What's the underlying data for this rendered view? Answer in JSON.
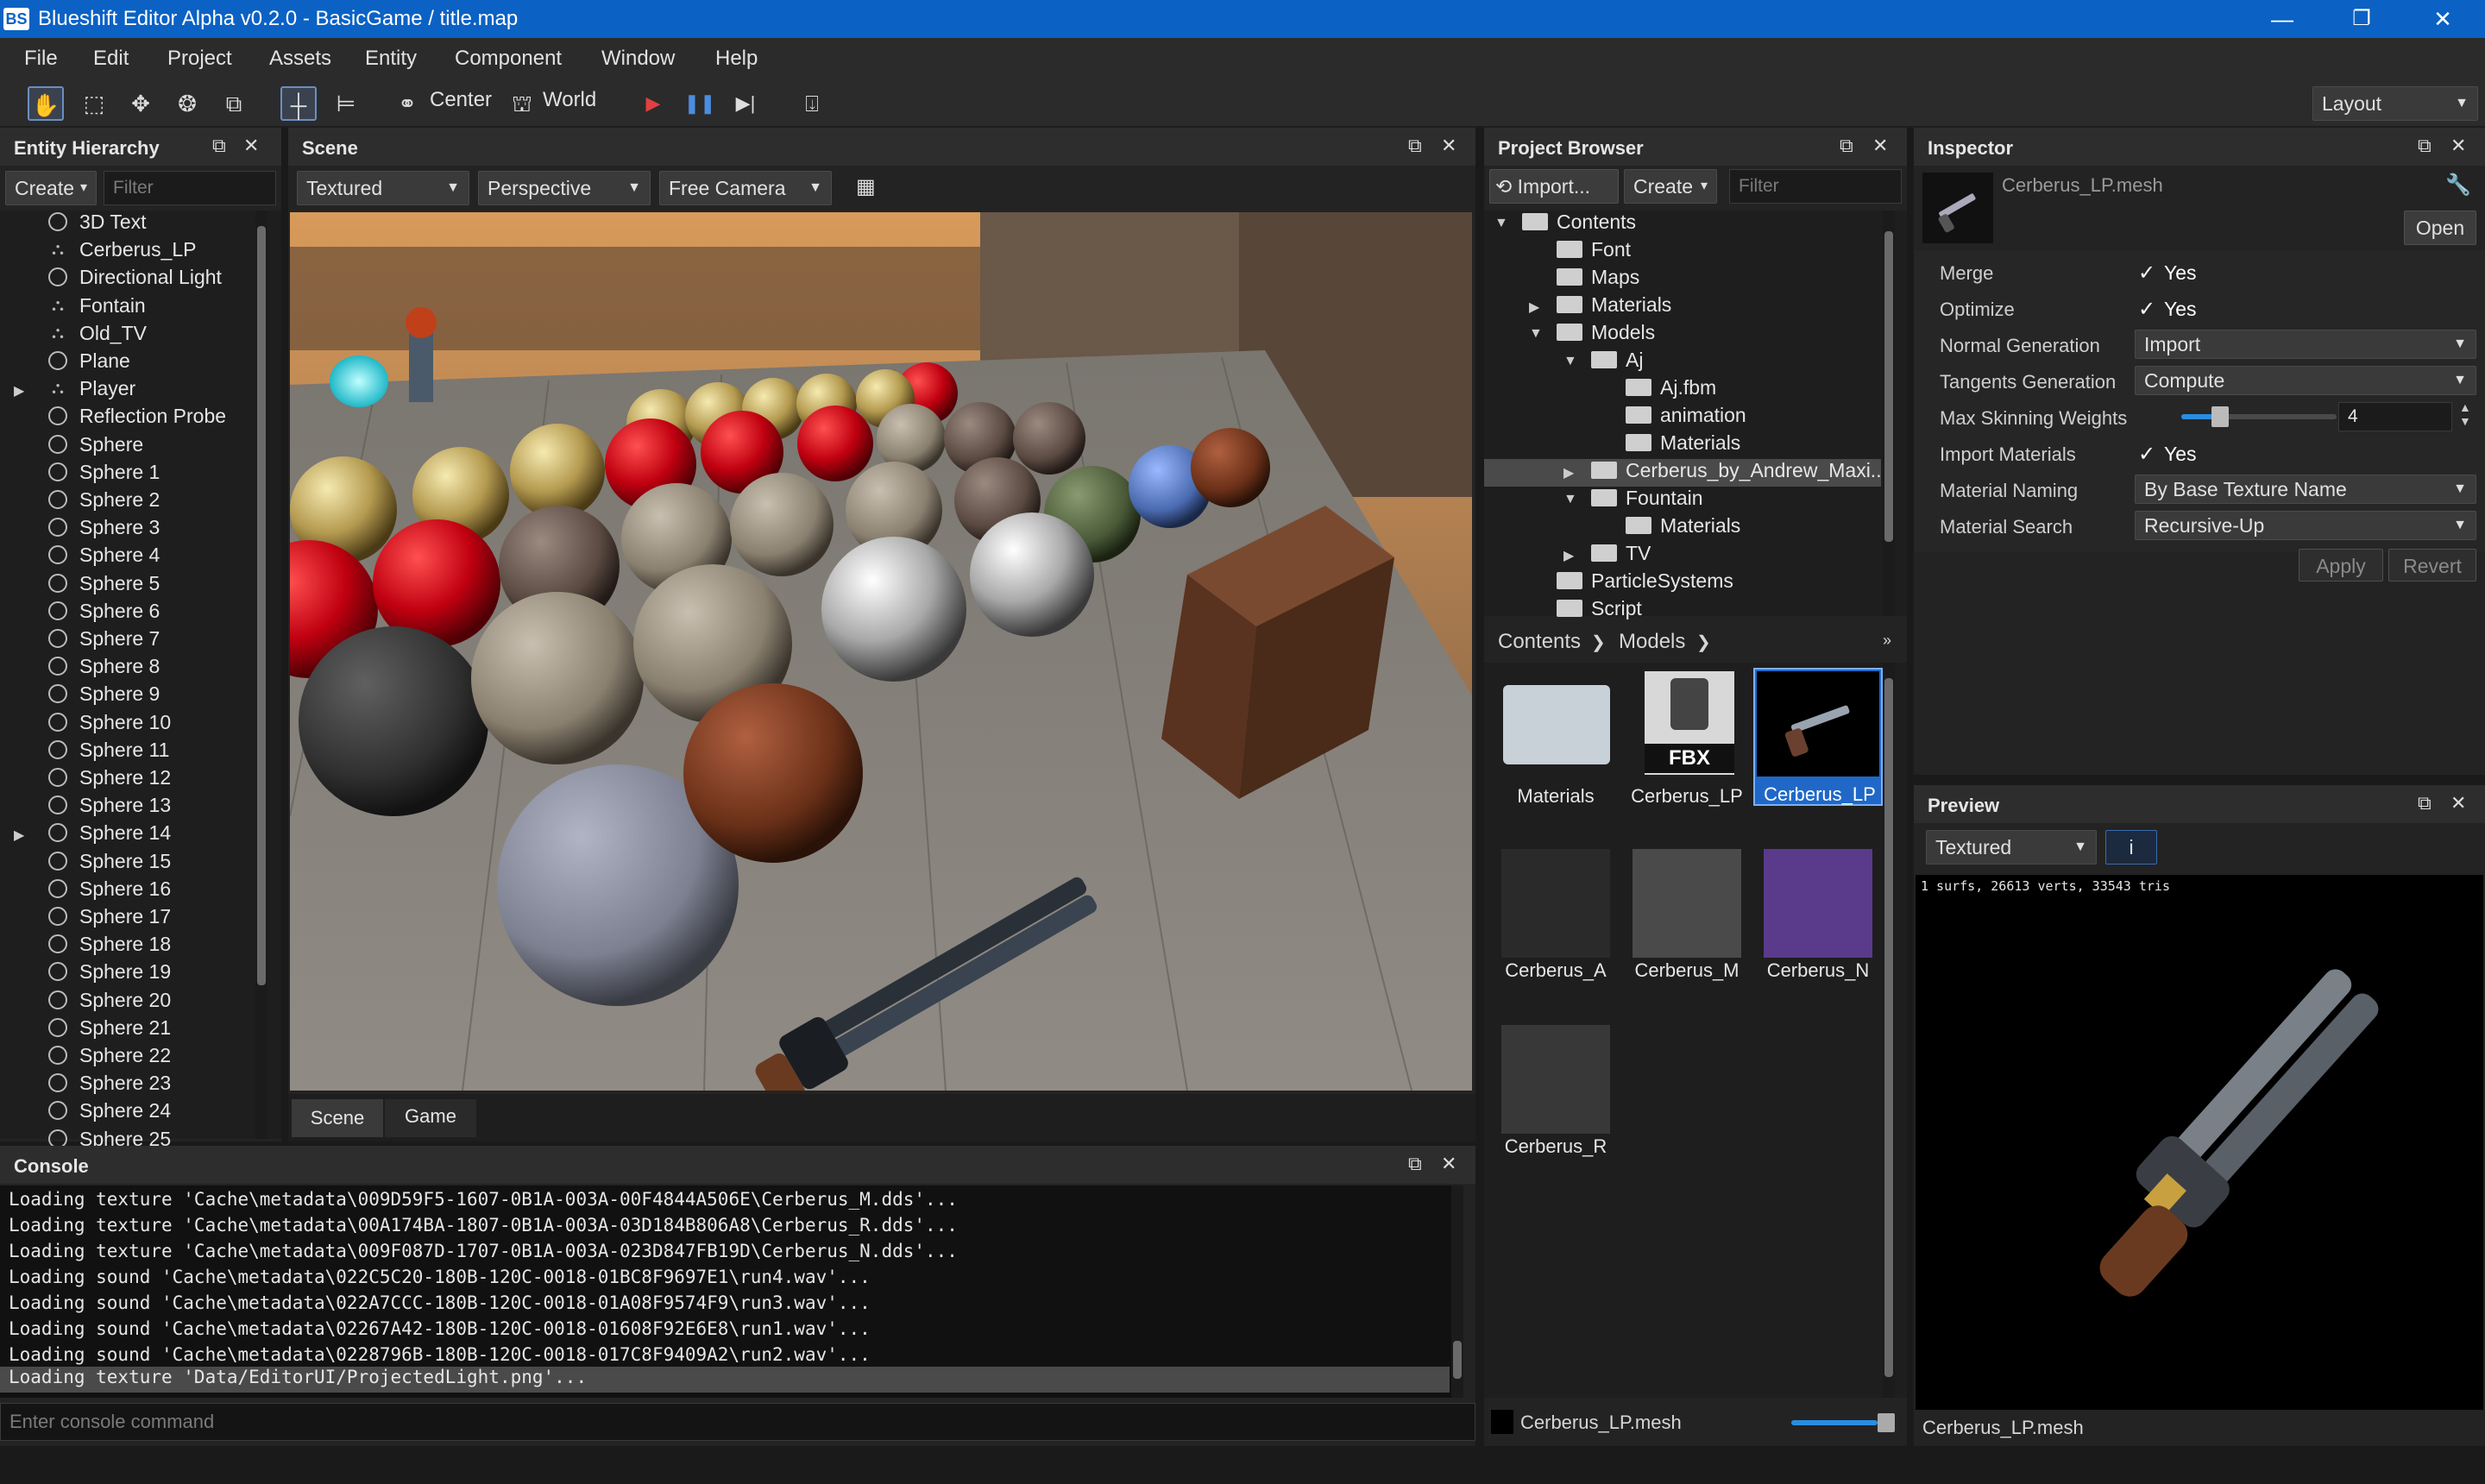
{
  "window": {
    "title": "Blueshift Editor Alpha v0.2.0 - BasicGame / title.map",
    "logo": "BS"
  },
  "window_controls": {
    "minimize": "—",
    "maximize": "❐",
    "close": "✕"
  },
  "menu": [
    "File",
    "Edit",
    "Project",
    "Assets",
    "Entity",
    "Component",
    "Window",
    "Help"
  ],
  "toolbar": {
    "center_label": "Center",
    "world_label": "World",
    "layout_label": "Layout"
  },
  "hierarchy": {
    "title": "Entity Hierarchy",
    "create_label": "Create",
    "filter_placeholder": "Filter",
    "items": [
      "3D Text",
      "Cerberus_LP",
      "Directional Light",
      "Fontain",
      "Old_TV",
      "Plane",
      "Player",
      "Reflection Probe",
      "Sphere",
      "Sphere 1",
      "Sphere 2",
      "Sphere 3",
      "Sphere 4",
      "Sphere 5",
      "Sphere 6",
      "Sphere 7",
      "Sphere 8",
      "Sphere 9",
      "Sphere 10",
      "Sphere 11",
      "Sphere 12",
      "Sphere 13",
      "Sphere 14",
      "Sphere 15",
      "Sphere 16",
      "Sphere 17",
      "Sphere 18",
      "Sphere 19",
      "Sphere 20",
      "Sphere 21",
      "Sphere 22",
      "Sphere 23",
      "Sphere 24",
      "Sphere 25"
    ]
  },
  "scene": {
    "title": "Scene",
    "render_mode": "Textured",
    "projection": "Perspective",
    "camera": "Free Camera",
    "tabs": [
      "Scene",
      "Game"
    ]
  },
  "project": {
    "title": "Project Browser",
    "import_label": "Import...",
    "create_label": "Create",
    "filter_placeholder": "Filter",
    "tree": [
      "Contents",
      "Font",
      "Maps",
      "Materials",
      "Models",
      "Aj",
      "Aj.fbm",
      "animation",
      "Materials",
      "Cerberus_by_Andrew_Maxi...",
      "Fountain",
      "Materials",
      "TV",
      "ParticleSystems",
      "Script"
    ],
    "breadcrumb": [
      "Contents",
      "Models"
    ],
    "assets": [
      "Materials",
      "Cerberus_LP",
      "Cerberus_LP",
      "Cerberus_A",
      "Cerberus_M",
      "Cerberus_N",
      "Cerberus_R"
    ],
    "fbx_badge": "FBX",
    "status_file": "Cerberus_LP.mesh"
  },
  "inspector": {
    "title": "Inspector",
    "asset_name": "Cerberus_LP.mesh",
    "open_label": "Open",
    "props": {
      "merge": "Merge",
      "optimize": "Optimize",
      "normal_gen": "Normal Generation",
      "tangent_gen": "Tangents Generation",
      "max_skin": "Max Skinning Weights",
      "import_mat": "Import Materials",
      "mat_naming": "Material Naming",
      "mat_search": "Material Search"
    },
    "values": {
      "yes": "Yes",
      "normal_gen": "Import",
      "tangent_gen": "Compute",
      "max_skin": "4",
      "max_skin_fraction": 0.25,
      "mat_naming": "By Base Texture Name",
      "mat_search": "Recursive-Up"
    },
    "apply_label": "Apply",
    "revert_label": "Revert"
  },
  "preview": {
    "title": "Preview",
    "mode": "Textured",
    "info_button": "i",
    "stats": "1 surfs, 26613 verts, 33543 tris",
    "footer": "Cerberus_LP.mesh"
  },
  "console": {
    "title": "Console",
    "lines": [
      "Loading texture 'Cache\\metadata\\009D59F5-1607-0B1A-003A-00F4844A506E\\Cerberus_M.dds'...",
      "Loading texture 'Cache\\metadata\\00A174BA-1807-0B1A-003A-03D184B806A8\\Cerberus_R.dds'...",
      "Loading texture 'Cache\\metadata\\009F087D-1707-0B1A-003A-023D847FB19D\\Cerberus_N.dds'...",
      "Loading sound 'Cache\\metadata\\022C5C20-180B-120C-0018-01BC8F9697E1\\run4.wav'...",
      "Loading sound 'Cache\\metadata\\022A7CCC-180B-120C-0018-01A08F9574F9\\run3.wav'...",
      "Loading sound 'Cache\\metadata\\02267A42-180B-120C-0018-01608F92E6E8\\run1.wav'...",
      "Loading sound 'Cache\\metadata\\0228796B-180B-120C-0018-017C8F9409A2\\run2.wav'...",
      "Loading texture 'Data/EditorUI/ProjectedLight.png'..."
    ],
    "command_placeholder": "Enter console command"
  }
}
